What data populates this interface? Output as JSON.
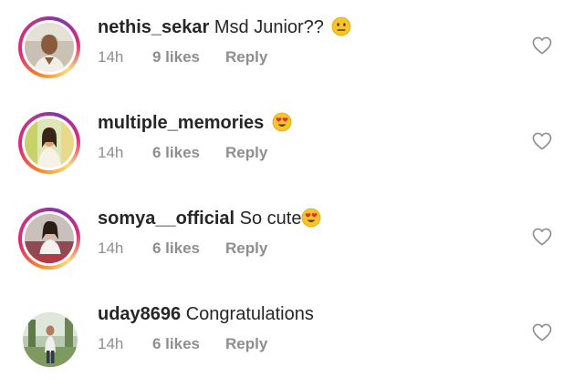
{
  "comments": [
    {
      "username": "nethis_sekar",
      "text": "Msd Junior??",
      "emoji": "neutral-face",
      "time": "14h",
      "likes": "9 likes",
      "reply": "Reply",
      "has_story_ring": true
    },
    {
      "username": "multiple_memories",
      "text": "",
      "emoji": "heart-eyes",
      "time": "14h",
      "likes": "6 likes",
      "reply": "Reply",
      "has_story_ring": true
    },
    {
      "username": "somya__official",
      "text": "So cute",
      "emoji": "heart-eyes",
      "time": "14h",
      "likes": "6 likes",
      "reply": "Reply",
      "has_story_ring": true
    },
    {
      "username": "uday8696",
      "text": "Congratulations",
      "emoji": "",
      "time": "14h",
      "likes": "6 likes",
      "reply": "Reply",
      "has_story_ring": false
    }
  ],
  "colors": {
    "username": "#262626",
    "meta": "#8e8e8e",
    "heart_outline": "#8e8e8e",
    "emoji_face": "#f7c52b"
  }
}
